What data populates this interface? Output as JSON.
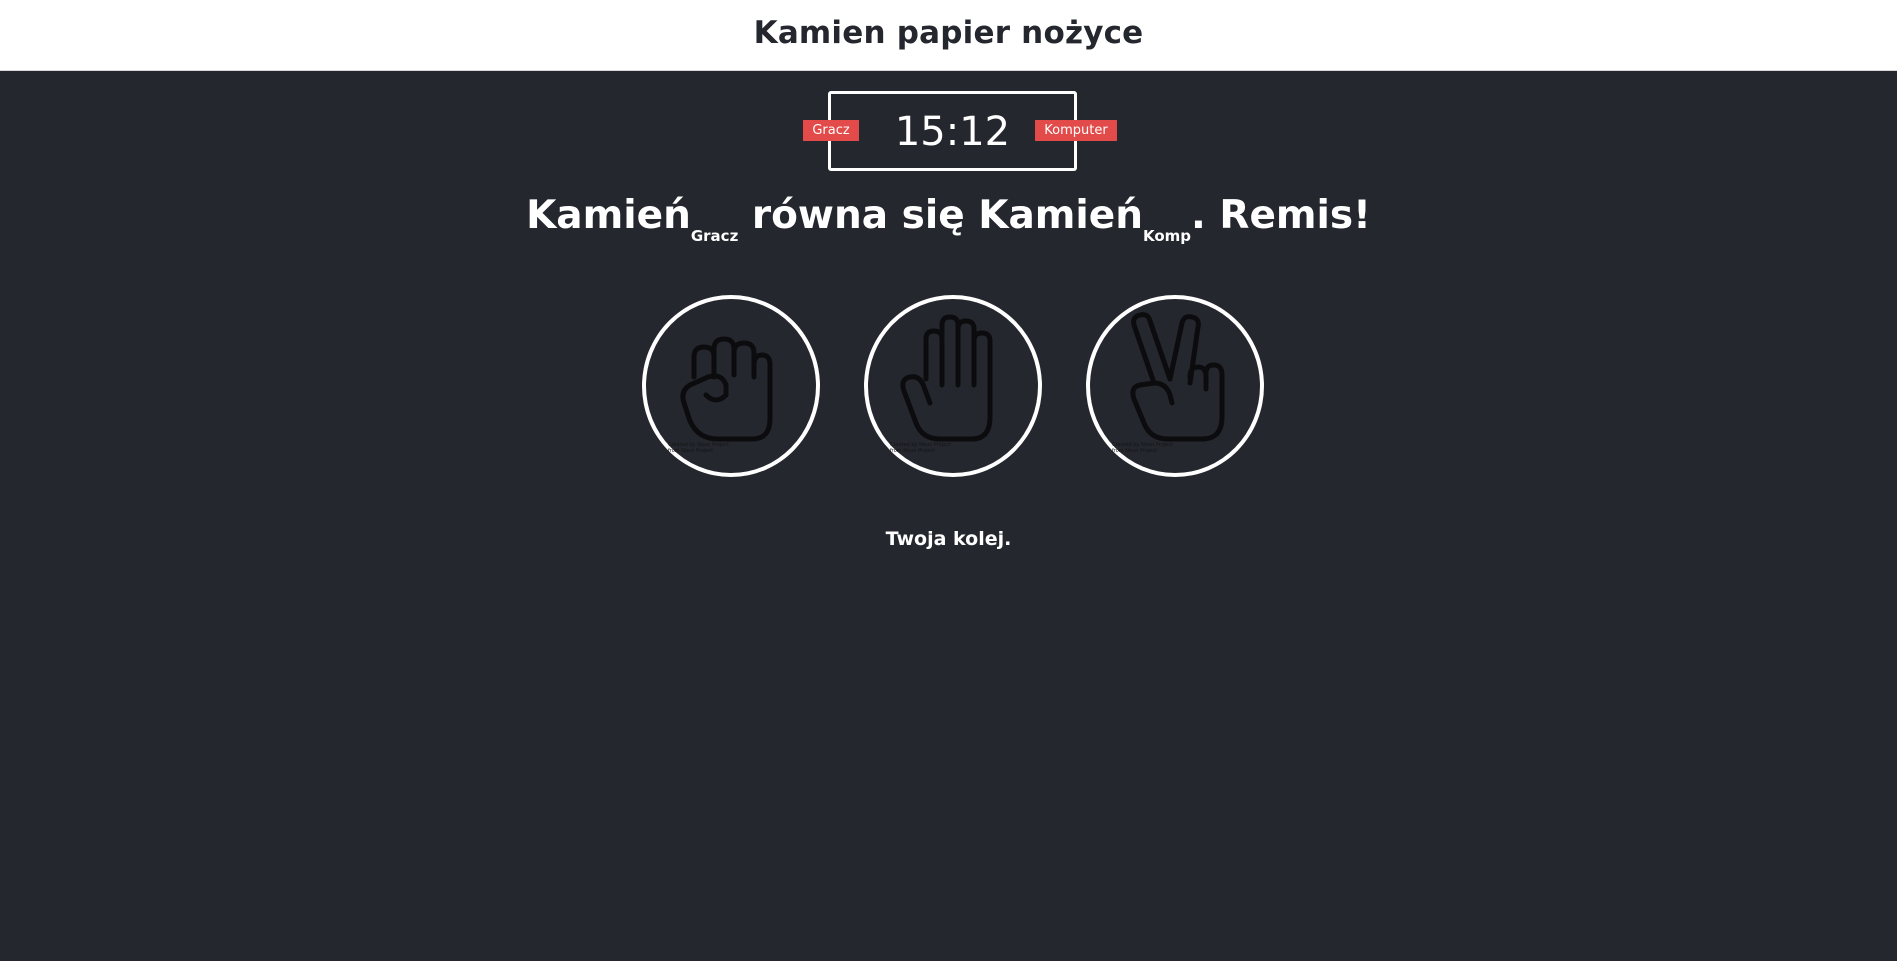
{
  "header": {
    "title": "Kamien papier nożyce"
  },
  "scoreboard": {
    "user_score": "15",
    "separator": ":",
    "computer_score": "12",
    "user_label": "Gracz",
    "computer_label": "Komputer"
  },
  "result": {
    "user_choice": "Kamień",
    "user_sub": "Gracz",
    "middle_text": " równa się ",
    "computer_choice": "Kamień",
    "computer_sub": "Komp",
    "outcome": ". Remis!"
  },
  "choices": [
    {
      "id": "r",
      "icon": "rock-hand-icon"
    },
    {
      "id": "p",
      "icon": "paper-hand-icon"
    },
    {
      "id": "s",
      "icon": "scissors-hand-icon"
    }
  ],
  "message": "Twoja kolej.",
  "colors": {
    "background": "#25272e",
    "header_background": "#ffffff",
    "badge": "#e24b4a",
    "text": "#ffffff"
  }
}
